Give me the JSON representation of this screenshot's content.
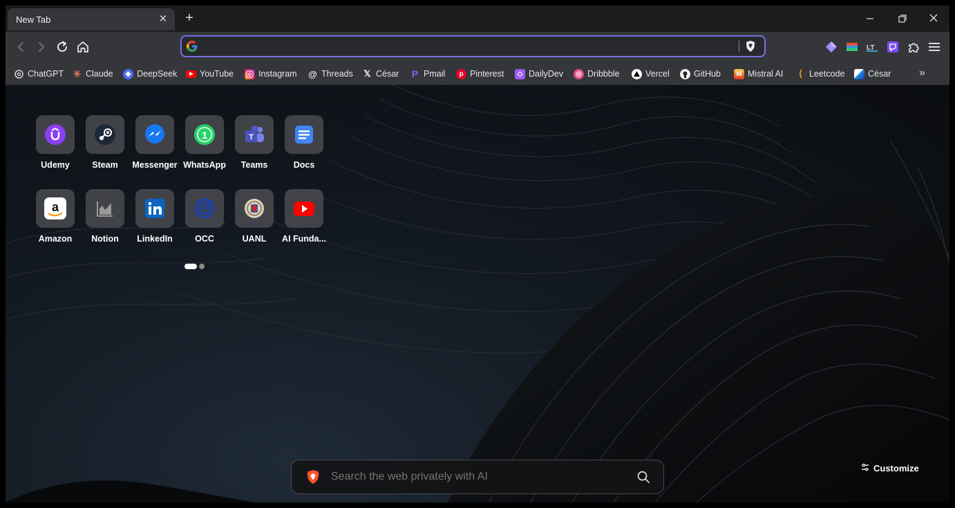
{
  "tab": {
    "title": "New Tab",
    "close": "✕"
  },
  "new_tab": "+",
  "omnibox": {
    "value": "",
    "placeholder": ""
  },
  "bookmarks": [
    {
      "label": "ChatGPT",
      "icon": "chatgpt-icon"
    },
    {
      "label": "Claude",
      "icon": "claude-icon"
    },
    {
      "label": "DeepSeek",
      "icon": "deepseek-icon"
    },
    {
      "label": "YouTube",
      "icon": "youtube-icon"
    },
    {
      "label": "Instagram",
      "icon": "instagram-icon"
    },
    {
      "label": "Threads",
      "icon": "threads-icon"
    },
    {
      "label": "César",
      "icon": "x-icon"
    },
    {
      "label": "Pmail",
      "icon": "pmail-icon"
    },
    {
      "label": "Pinterest",
      "icon": "pinterest-icon"
    },
    {
      "label": "DailyDev",
      "icon": "dailydev-icon"
    },
    {
      "label": "Dribbble",
      "icon": "dribbble-icon"
    },
    {
      "label": "Vercel",
      "icon": "vercel-icon"
    },
    {
      "label": "GitHub",
      "icon": "github-icon"
    },
    {
      "label": "Mistral AI",
      "icon": "mistral-icon"
    },
    {
      "label": "Leetcode",
      "icon": "leetcode-icon"
    },
    {
      "label": "César",
      "icon": "profile-icon"
    }
  ],
  "bookmarks_overflow": "»",
  "top_sites": [
    {
      "label": "Udemy",
      "icon": "udemy-icon"
    },
    {
      "label": "Steam",
      "icon": "steam-icon"
    },
    {
      "label": "Messenger",
      "icon": "messenger-icon"
    },
    {
      "label": "WhatsApp",
      "icon": "whatsapp-icon"
    },
    {
      "label": "Teams",
      "icon": "teams-icon"
    },
    {
      "label": "Docs",
      "icon": "docs-icon"
    },
    {
      "label": "Amazon",
      "icon": "amazon-icon"
    },
    {
      "label": "Notion",
      "icon": "notion-icon"
    },
    {
      "label": "LinkedIn",
      "icon": "linkedin-icon"
    },
    {
      "label": "OCC",
      "icon": "occ-icon"
    },
    {
      "label": "UANL",
      "icon": "uanl-icon"
    },
    {
      "label": "AI Funda...",
      "icon": "youtube-icon"
    }
  ],
  "search": {
    "placeholder": "Search the web privately with AI"
  },
  "customize": {
    "label": "Customize"
  },
  "colors": {
    "accent": "#7a6ee8",
    "brave": "#fb542b"
  }
}
